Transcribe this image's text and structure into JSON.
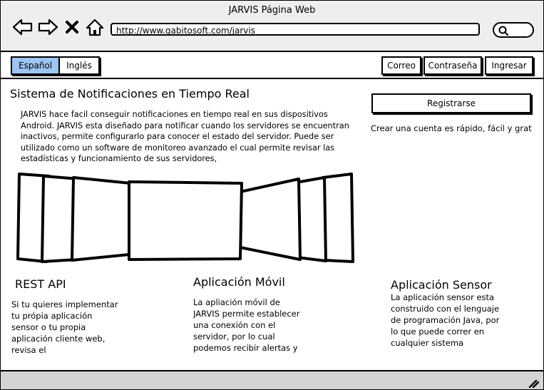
{
  "window": {
    "title": "JARVIS Página Web"
  },
  "browser": {
    "url": "http://www.gabitosoft.com/jarvis"
  },
  "icons": {
    "back": "back-arrow-icon",
    "forward": "forward-arrow-icon",
    "stop": "close-icon",
    "home": "home-icon",
    "search": "search-icon",
    "resize": "resize-grip-icon"
  },
  "toolbar": {
    "languages": [
      {
        "label": "Español",
        "active": true
      },
      {
        "label": "Inglés",
        "active": false
      }
    ],
    "correo": "Correo",
    "password": "Contraseña",
    "login": "Ingresar"
  },
  "main": {
    "title": "Sistema de Notificaciones en Tiempo Real",
    "intro": "JARVIS hace facil conseguir notificaciones en tiempo real en sus dispositivos Android. JARVIS esta diseñado para notificar cuando los servidores se encuentran inactivos, permite configurarlo para conocer el estado del servidor. Puede ser utilizado como un software de monitoreo avanzado el cual permite revisar las estadísticas y funcionamiento de sus servidores,"
  },
  "sidebar": {
    "register": "Registrarse",
    "note": "Crear una cuenta es rápido, fácil y gratuito"
  },
  "sections": [
    {
      "title": "REST API",
      "text": "Si tu quieres implementar tu própia aplicación sensor o tu propia aplicación cliente web, revisa el"
    },
    {
      "title": "Aplicación Móvil",
      "text": "La apliación móvil de JARVIS permite establecer una conexión con el servidor, por lo cual podemos recibir alertas y notificaciones"
    },
    {
      "title": "Aplicación Sensor",
      "text": "La aplicación sensor esta construido con el lenguaje de programación Java, por lo que puede correr en cualquier sistema"
    }
  ],
  "colors": {
    "active_tab": "#9dc5f3",
    "title_bar": "#eeeeee",
    "status_bar": "#d4d4d4"
  }
}
